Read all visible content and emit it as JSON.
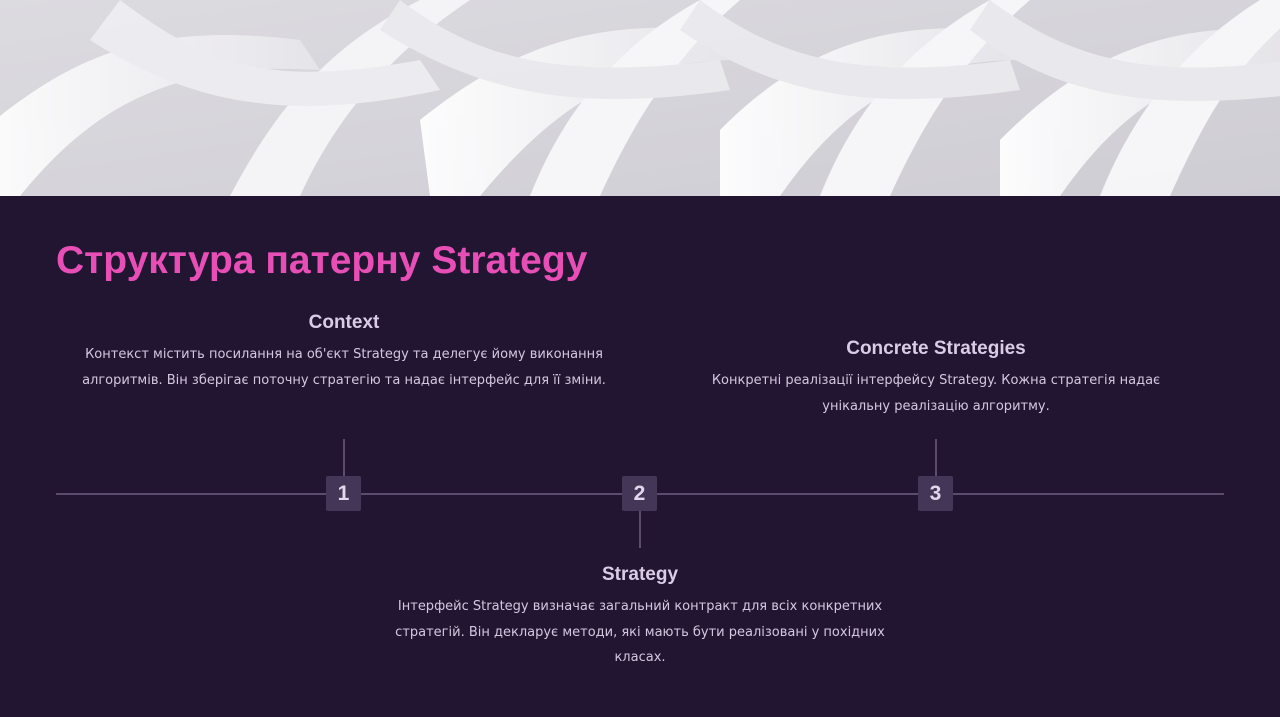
{
  "slide": {
    "title": "Структура патерну Strategy",
    "steps": [
      {
        "number": "1",
        "title": "Context",
        "description": "Контекст містить посилання на об'єкт Strategy та делегує йому виконання алгоритмів. Він зберігає поточну стратегію та надає інтерфейс для її зміни."
      },
      {
        "number": "2",
        "title": "Strategy",
        "description": "Інтерфейс Strategy визначає загальний контракт для всіх конкретних стратегій. Він декларує методи, які мають бути реалізовані у похідних класах."
      },
      {
        "number": "3",
        "title": "Concrete Strategies",
        "description": "Конкретні реалізації інтерфейсу Strategy. Кожна стратегія надає унікальну реалізацію алгоритму."
      }
    ]
  },
  "colors": {
    "background": "#221532",
    "accent": "#e84fb6",
    "marker": "#433657",
    "line": "#5b4c6d",
    "text": "#d4c8e0"
  }
}
